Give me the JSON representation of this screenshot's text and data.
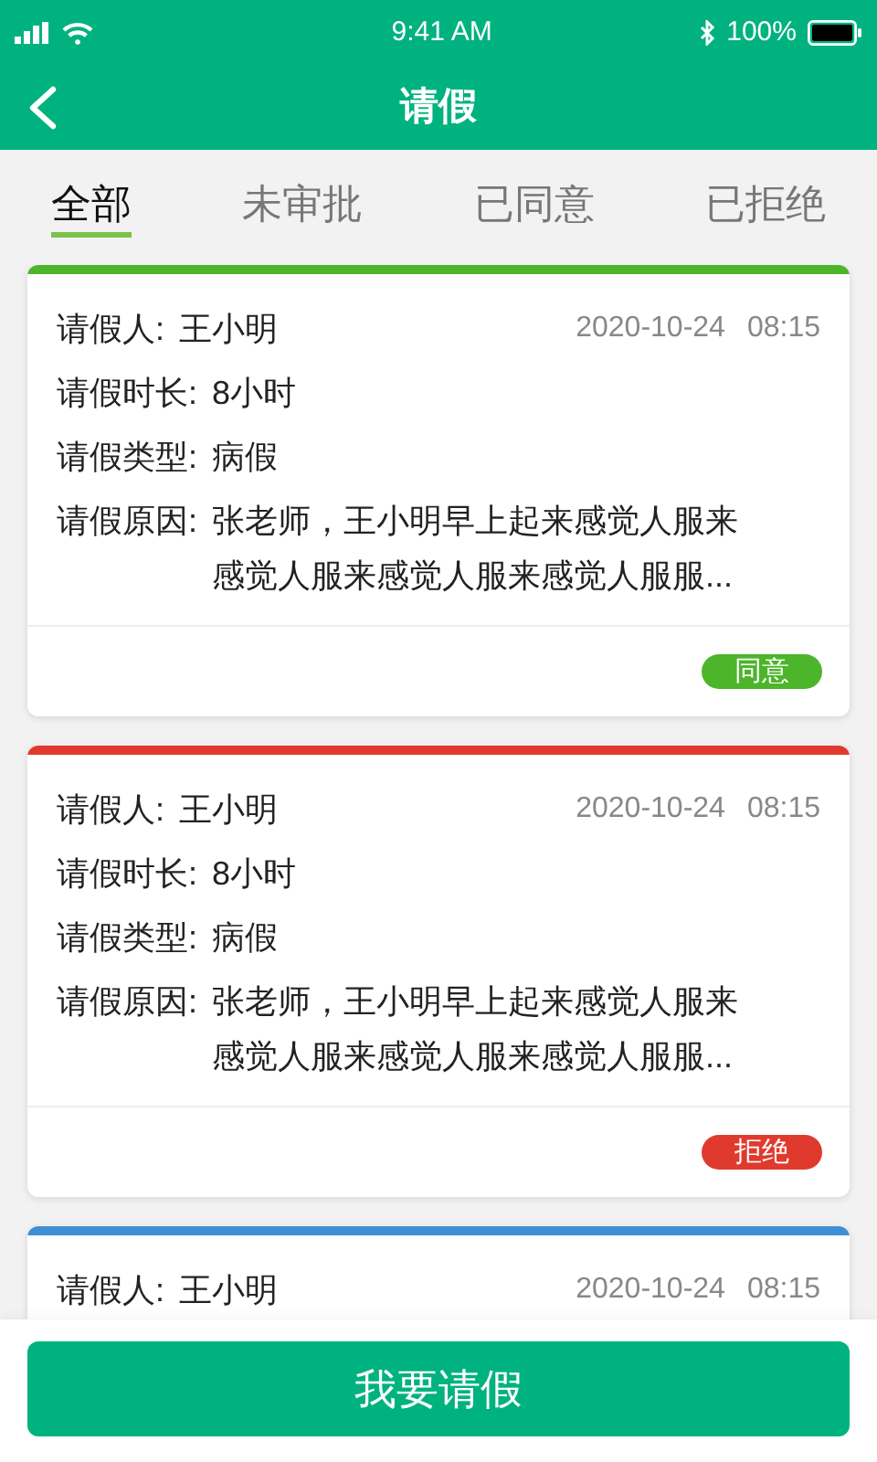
{
  "status_bar": {
    "time": "9:41 AM",
    "battery": "100%"
  },
  "header": {
    "title": "请假"
  },
  "tabs": [
    {
      "label": "全部",
      "selected": true
    },
    {
      "label": "未审批",
      "selected": false
    },
    {
      "label": "已同意",
      "selected": false
    },
    {
      "label": "已拒绝",
      "selected": false
    }
  ],
  "leave_requests": [
    {
      "color": "#4cb52a",
      "date": "2020-10-24",
      "time": "08:15",
      "fields": [
        {
          "label": "请假人:",
          "value": "王小明"
        },
        {
          "label": "请假时长:",
          "value": "8小时"
        },
        {
          "label": "请假类型:",
          "value": "病假"
        },
        {
          "label": "请假原因:",
          "value": "张老师，王小明早上起来感觉人服来感觉人服来感觉人服来感觉人服服..."
        }
      ],
      "status": {
        "label": "同意",
        "color": "#4cb52a"
      }
    },
    {
      "color": "#e03a2e",
      "date": "2020-10-24",
      "time": "08:15",
      "fields": [
        {
          "label": "请假人:",
          "value": "王小明"
        },
        {
          "label": "请假时长:",
          "value": "8小时"
        },
        {
          "label": "请假类型:",
          "value": "病假"
        },
        {
          "label": "请假原因:",
          "value": "张老师，王小明早上起来感觉人服来感觉人服来感觉人服来感觉人服服..."
        }
      ],
      "status": {
        "label": "拒绝",
        "color": "#e03a2e"
      }
    },
    {
      "color": "#3f8fd6",
      "date": "2020-10-24",
      "time": "08:15",
      "fields": [
        {
          "label": "请假人:",
          "value": "王小明"
        }
      ]
    }
  ],
  "action_button": "我要请假"
}
